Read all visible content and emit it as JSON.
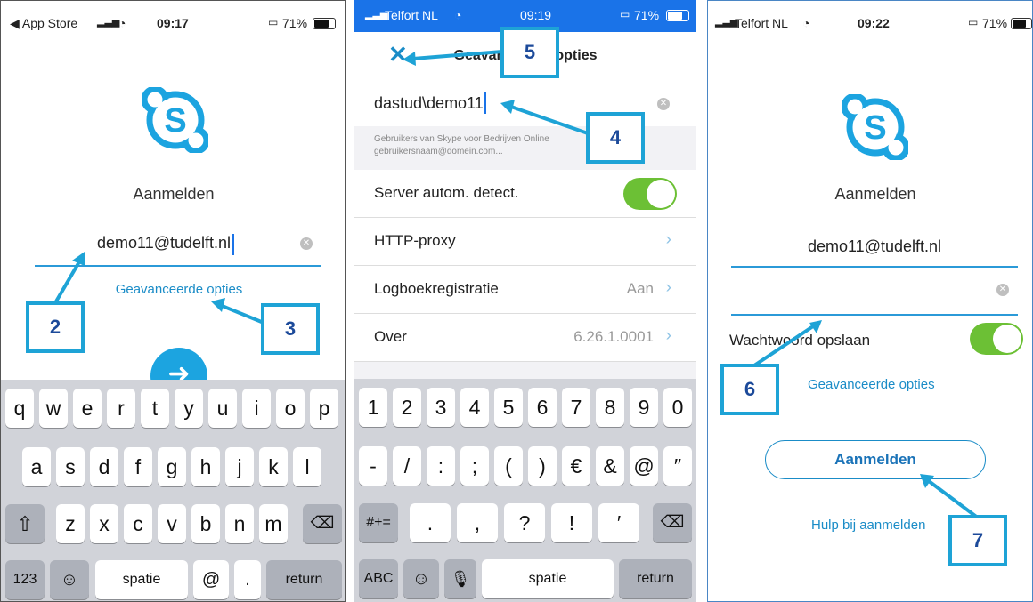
{
  "colors": {
    "accent": "#1a8cc7",
    "toggle_on": "#6cc035",
    "callout": "#1ea3d6",
    "callout_text": "#1c4a9a",
    "ios_blue": "#1a73e8"
  },
  "panel1": {
    "status": {
      "back": "◀ App Store",
      "time": "09:17",
      "battery": "71%"
    },
    "heading": "Aanmelden",
    "email_value": "demo11@tudelft.nl",
    "advanced_link": "Geavanceerde opties",
    "callouts": [
      "2",
      "3"
    ],
    "keyboard": {
      "row1": [
        "q",
        "w",
        "e",
        "r",
        "t",
        "y",
        "u",
        "i",
        "o",
        "p"
      ],
      "row2": [
        "a",
        "s",
        "d",
        "f",
        "g",
        "h",
        "j",
        "k",
        "l"
      ],
      "row3": [
        "z",
        "x",
        "c",
        "v",
        "b",
        "n",
        "m"
      ],
      "bottom": {
        "numbers": "123",
        "space": "spatie",
        "at": "@",
        "dot": ".",
        "return": "return"
      }
    }
  },
  "panel2": {
    "status": {
      "carrier": "Telfort NL",
      "time": "09:19",
      "battery": "71%"
    },
    "title": "Geavanceerde opties",
    "username_value": "dastud\\demo11",
    "hint": "Gebruikers van Skype voor Bedrijven Online gebruikersnaam@domein.com...",
    "rows": [
      {
        "label": "Server autom. detect.",
        "value": ""
      },
      {
        "label": "HTTP-proxy",
        "value": ""
      },
      {
        "label": "Logboekregistratie",
        "value": "Aan"
      },
      {
        "label": "Over",
        "value": "6.26.1.0001"
      }
    ],
    "callouts": [
      "5",
      "4"
    ],
    "keyboard": {
      "row1": [
        "1",
        "2",
        "3",
        "4",
        "5",
        "6",
        "7",
        "8",
        "9",
        "0"
      ],
      "row2": [
        "-",
        "/",
        ":",
        ";",
        "(",
        ")",
        "€",
        "&",
        "@",
        "″"
      ],
      "row3": [
        ".",
        ",",
        "?",
        "!",
        "′"
      ],
      "symbols": "#+=",
      "bottom": {
        "abc": "ABC",
        "space": "spatie",
        "return": "return"
      }
    }
  },
  "panel3": {
    "status": {
      "carrier": "Telfort NL",
      "time": "09:22",
      "battery": "71%"
    },
    "heading": "Aanmelden",
    "email_value": "demo11@tudelft.nl",
    "save_password_label": "Wachtwoord opslaan",
    "advanced_link": "Geavanceerde opties",
    "signin_button": "Aanmelden",
    "help_link": "Hulp bij aanmelden",
    "callouts": [
      "6",
      "7"
    ]
  }
}
